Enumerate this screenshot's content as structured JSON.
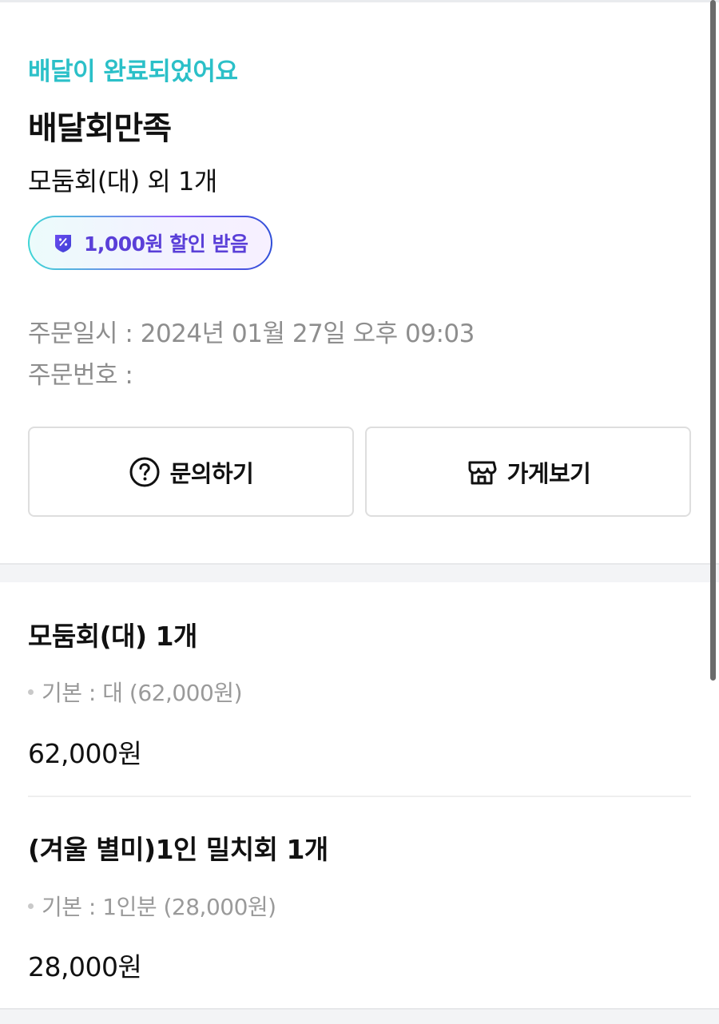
{
  "order": {
    "status": "배달이 완료되었어요",
    "store_name": "배달회만족",
    "summary": "모둠회(대) 외 1개",
    "discount_badge": "1,000원 할인 받음",
    "order_datetime": "주문일시 : 2024년 01월 27일 오후 09:03",
    "order_number": "주문번호 : "
  },
  "actions": {
    "inquiry_label": "문의하기",
    "store_label": "가게보기"
  },
  "items": [
    {
      "name": "모둠회(대) 1개",
      "option": "기본 : 대 (62,000원)",
      "price": "62,000원"
    },
    {
      "name": "(겨울 별미)1인 밀치회 1개",
      "option": "기본 : 1인분 (28,000원)",
      "price": "28,000원"
    }
  ],
  "icons": {
    "discount": "discount-coupon-icon",
    "inquiry": "question-circle-icon",
    "store": "store-awning-icon"
  },
  "colors": {
    "status": "#2bc0c8",
    "discount_text": "#5a3fd8",
    "muted_text": "#8e8e8e"
  }
}
